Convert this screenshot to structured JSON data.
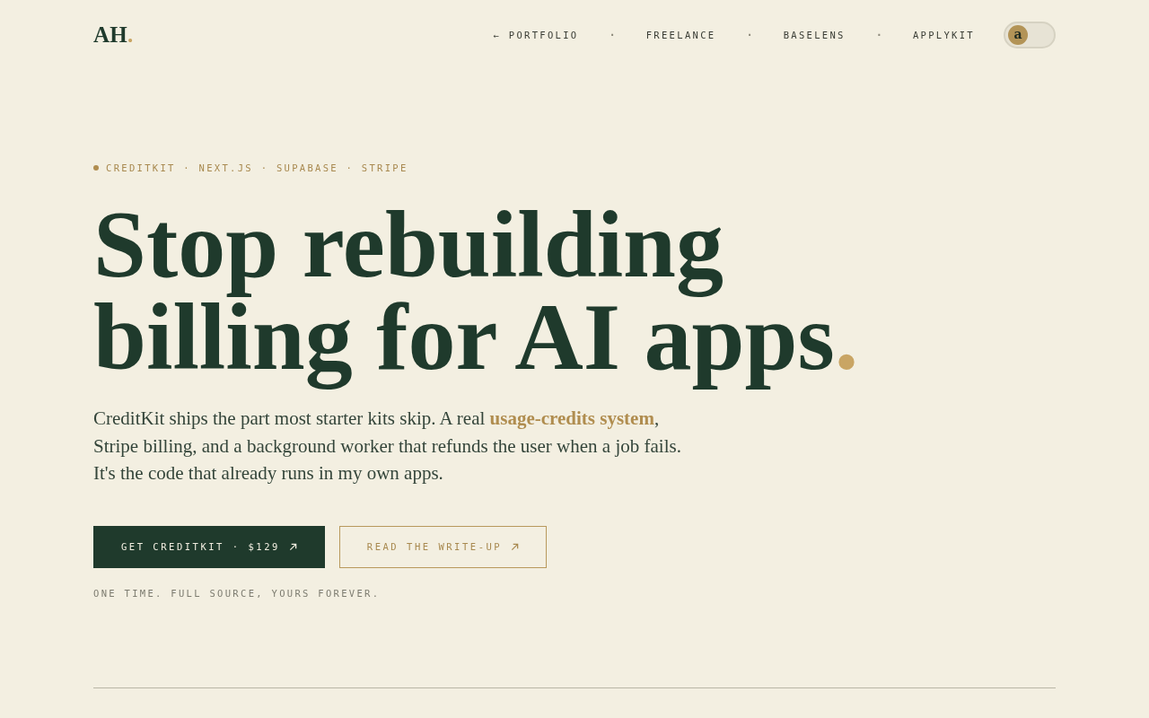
{
  "header": {
    "logo": {
      "text": "AH",
      "mark": "."
    },
    "nav": [
      {
        "label": "← PORTFOLIO",
        "separator": "·"
      },
      {
        "label": "FREELANCE",
        "separator": "·"
      },
      {
        "label": "BASELENS",
        "separator": "·"
      },
      {
        "label": "APPLYKIT"
      }
    ],
    "theme_toggle": {
      "knob_label": "a",
      "on": false
    }
  },
  "hero": {
    "eyebrow": "CREDITKIT · NEXT.JS · SUPABASE · STRIPE",
    "headline": [
      "Stop rebuilding",
      "billing for AI apps"
    ],
    "headline_mark": ".",
    "lead": "CreditKit ships the part most starter kits skip. A real **usage-credits system**, Stripe billing, and a background worker that refunds the user when a job fails. It's the code that already runs in my own apps.",
    "buttons": [
      {
        "label": "GET CREDITKIT · $129",
        "kind": "primary"
      },
      {
        "label": "READ THE WRITE-UP",
        "kind": "outline"
      }
    ],
    "note": "ONE TIME. FULL SOURCE, YOURS FOREVER."
  }
}
